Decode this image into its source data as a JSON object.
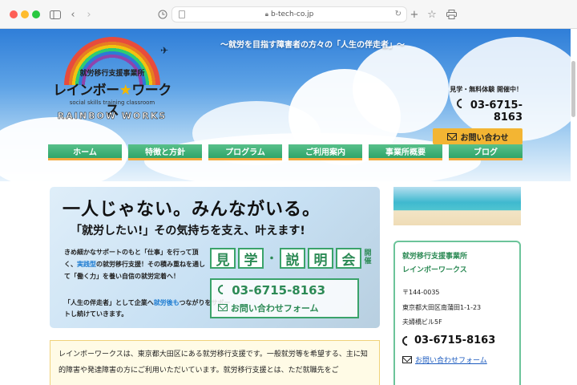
{
  "browser": {
    "url": "b-tech-co.jp"
  },
  "header": {
    "tagline": "〜就労を目指す障害者の方々の「人生の伴走者」〜",
    "logo": {
      "subtitle": "就労移行支援事業所",
      "name_left": "レインボー",
      "name_right": "ワークス",
      "english_small": "social skills training classroom",
      "english_big": "RAINBOW WORKS"
    },
    "contact": {
      "trial": "見学・無料体験 開催中！",
      "tel": "03-6715-8163",
      "inquiry_button": "お問い合わせ"
    }
  },
  "nav": {
    "items": [
      "ホーム",
      "特徴と方針",
      "プログラム",
      "ご利用案内",
      "事業所概要",
      "ブログ"
    ]
  },
  "banner": {
    "headline": "一人じゃない。みんながいる。",
    "subhead": "「就労したい!」その気持ちを支え、叶えます!",
    "body_1": "きめ細かなサポートのもと「仕事」を行って頂く、",
    "body_2": "実践型",
    "body_3": "の就労移行支援！その積み重ねを通して「働く力」を養い自信の就労定着へ！",
    "foot_1": "「人生の伴走者」として企業へ",
    "foot_2": "就労後も",
    "foot_3": "つながりをサポートし続けていきます。",
    "visit_chars": [
      "見",
      "学",
      "説",
      "明",
      "会"
    ],
    "visit_dot": "・",
    "held": "開催",
    "tel": "03-6715-8163",
    "form_link": "お問い合わせフォーム"
  },
  "intro": {
    "text": "レインボーワークスは、東京都大田区にある就労移行支援です。一般就労等を希望する、主に知的障害や発達障害の方にご利用いただいています。就労移行支援とは、ただ就職先をご"
  },
  "sidebar": {
    "org_1": "就労移行支援事業所",
    "org_2": "レインボーワークス",
    "zip": "〒144-0035",
    "addr_1": "東京都大田区南蒲田1-1-23",
    "addr_2": "夫婦橋ビル5F",
    "tel": "03-6715-8163",
    "form_link": "お問い合わせフォーム"
  },
  "colors": {
    "nav_green": "#2fa56a",
    "accent_orange": "#f3b533",
    "banner_green": "#2c8a55",
    "link_blue": "#1c5bbf"
  }
}
